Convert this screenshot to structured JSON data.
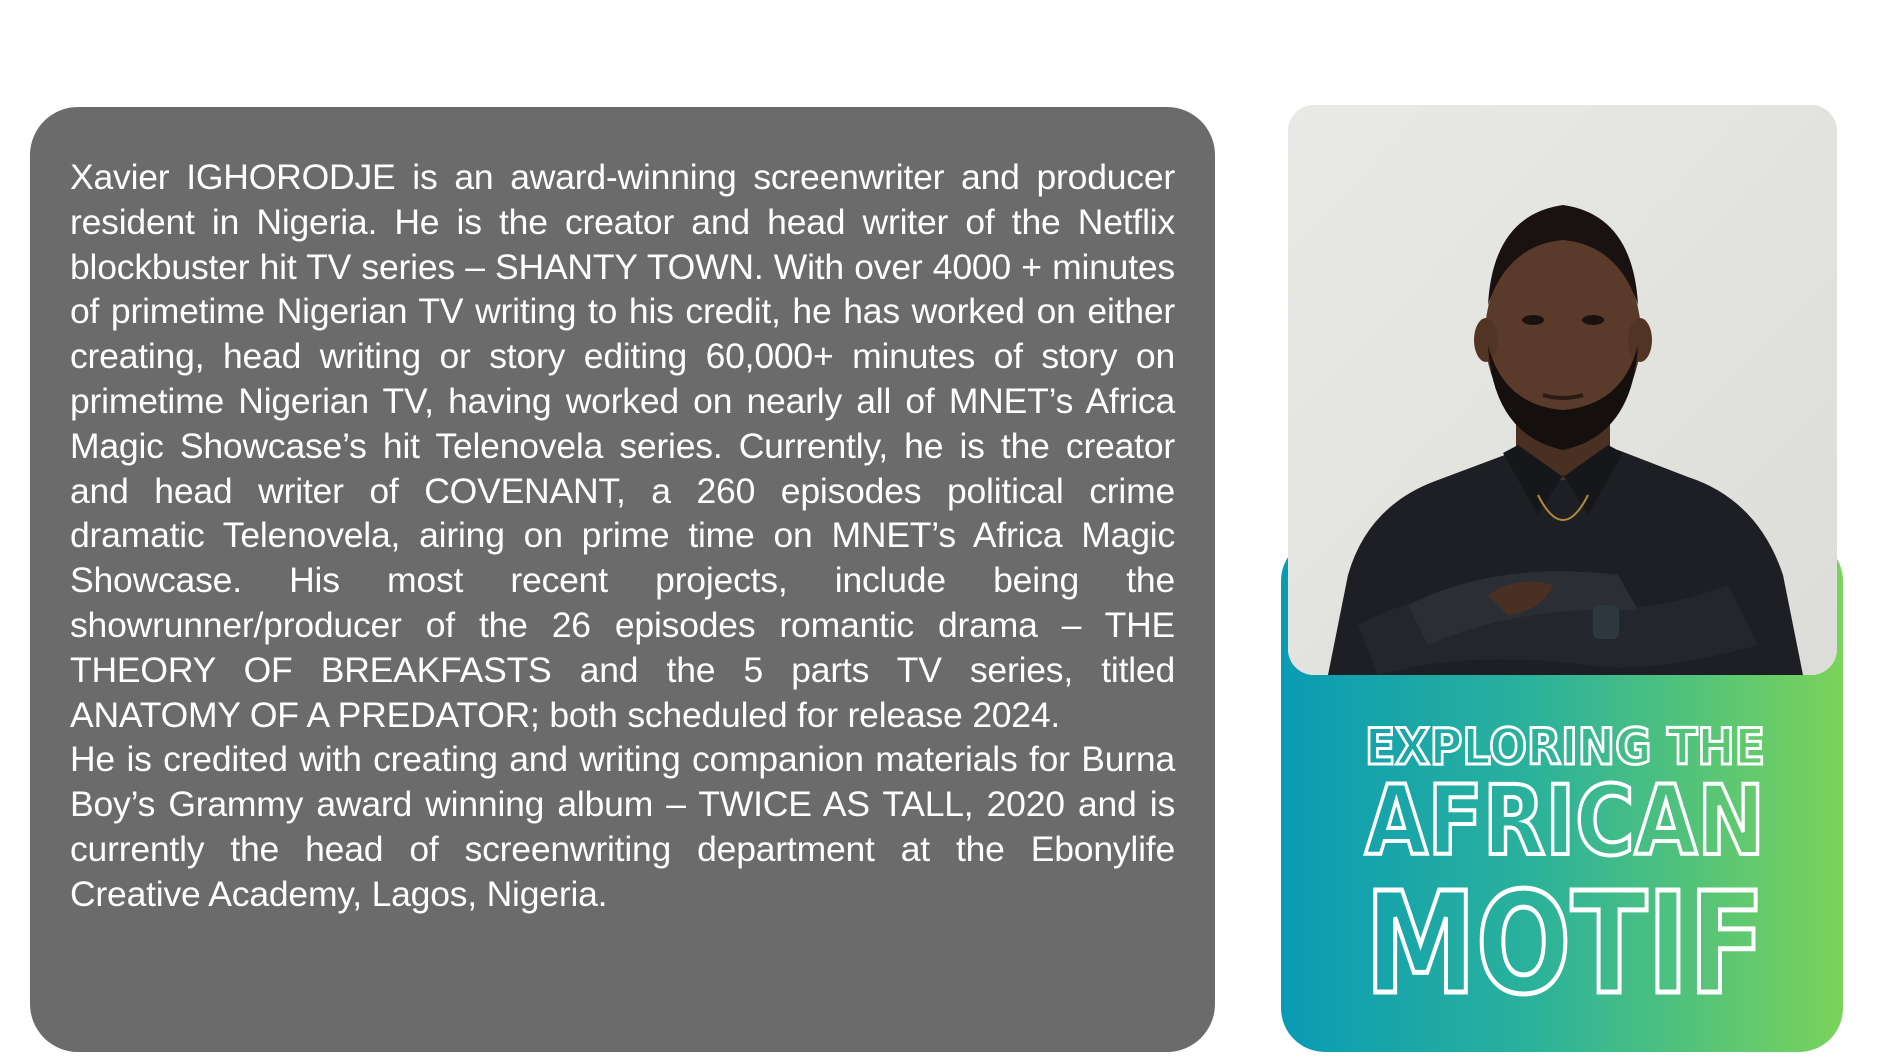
{
  "bio": {
    "paragraphs": [
      "Xavier IGHORODJE is an award-winning screenwriter and producer resident in Nigeria. He is the creator and head writer of the Netflix blockbuster hit TV series – SHANTY TOWN. With over 4000 + minutes of primetime Nigerian TV writing to his credit, he has worked on either creating, head writing or story editing 60,000+ minutes of story on primetime Nigerian TV, having worked on nearly all of MNET’s Africa Magic Showcase’s hit Telenovela series. Currently, he is the creator and head writer of COVENANT, a 260 episodes political crime dramatic Telenovela, airing on prime time on MNET’s Africa Magic Showcase. His most recent projects, include being the showrunner/producer of the 26 episodes romantic drama – THE THEORY OF BREAKFASTS and the 5 parts TV series, titled ANATOMY OF A PREDATOR; both scheduled for release 2024.",
      "He is credited with creating and writing companion materials for Burna Boy’s Grammy award winning album – TWICE AS TALL, 2020 and is currently the head of screenwriting department at the Ebonylife Creative Academy, Lagos, Nigeria."
    ]
  },
  "motif": {
    "line1": "EXPLORING THE",
    "line2": "AFRICAN",
    "line3": "MOTIF"
  },
  "colors": {
    "card_bg": "#6b6b6b",
    "gradient_start": "#0a9bb4",
    "gradient_end": "#7ad35a",
    "text": "#ffffff"
  }
}
